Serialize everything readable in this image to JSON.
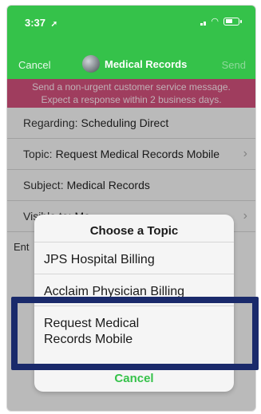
{
  "status_bar": {
    "time": "3:37",
    "location_icon": "location-arrow-icon"
  },
  "nav": {
    "cancel": "Cancel",
    "title": "Medical Records",
    "send": "Send"
  },
  "banner": {
    "line1": "Send a non-urgent customer service message.",
    "line2": "Expect a response within 2 business days."
  },
  "form": {
    "regarding": {
      "label": "Regarding:",
      "value": "Scheduling Direct"
    },
    "topic": {
      "label": "Topic:",
      "value": "Request Medical Records Mobile"
    },
    "subject": {
      "label": "Subject:",
      "value": "Medical Records"
    },
    "visible_to": {
      "label": "Visible to:",
      "value": "Me"
    },
    "enter_hint": "Ent"
  },
  "dialog": {
    "title": "Choose a Topic",
    "options": [
      "JPS Hospital Billing",
      "Acclaim Physician Billing",
      "Request Medical Records Mobile"
    ],
    "cancel": "Cancel"
  },
  "colors": {
    "header_green": "#35c24a",
    "banner_pink": "#cc4f79",
    "highlight_navy": "#1a2a6b"
  }
}
